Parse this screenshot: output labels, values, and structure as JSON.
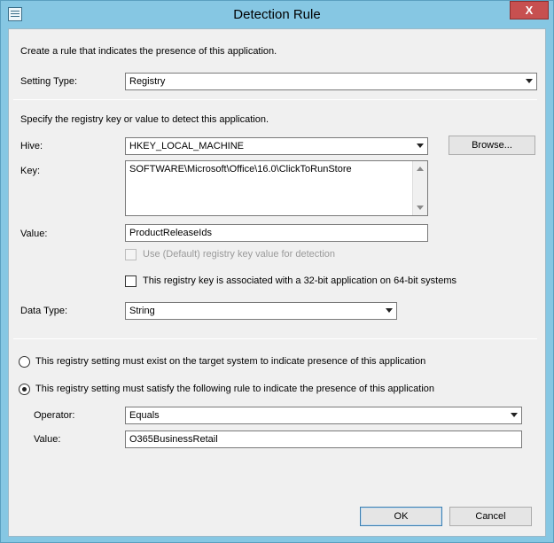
{
  "window": {
    "title": "Detection Rule",
    "close_label": "X"
  },
  "intro": "Create a rule that indicates the presence of this application.",
  "setting_type": {
    "label": "Setting Type:",
    "value": "Registry"
  },
  "registry": {
    "instruction": "Specify the registry key or value to detect this application.",
    "hive_label": "Hive:",
    "hive_value": "HKEY_LOCAL_MACHINE",
    "browse_label": "Browse...",
    "key_label": "Key:",
    "key_value": "SOFTWARE\\Microsoft\\Office\\16.0\\ClickToRunStore",
    "value_label": "Value:",
    "value_value": "ProductReleaseIds",
    "use_default_label": "Use (Default) registry key value for detection",
    "use_default_checked": false,
    "use_default_enabled": false,
    "bit32_label": "This registry key is associated with a 32-bit application on 64-bit systems",
    "bit32_checked": false,
    "data_type_label": "Data Type:",
    "data_type_value": "String"
  },
  "rule": {
    "option_exist_label": "This registry setting must exist on the target system to indicate presence of this application",
    "option_exist_selected": false,
    "option_satisfy_label": "This registry setting must satisfy the following rule to indicate the presence of this application",
    "option_satisfy_selected": true,
    "operator_label": "Operator:",
    "operator_value": "Equals",
    "value_label": "Value:",
    "value_value": "O365BusinessRetail"
  },
  "footer": {
    "ok_label": "OK",
    "cancel_label": "Cancel"
  },
  "icons": {
    "app": "window-icon",
    "close": "close-icon",
    "dropdown": "chevron-down-icon",
    "scroll_up": "scroll-up-icon",
    "scroll_down": "scroll-down-icon"
  },
  "colors": {
    "frame": "#86c7e3",
    "close_button": "#c75050",
    "client": "#f0f0f0"
  }
}
